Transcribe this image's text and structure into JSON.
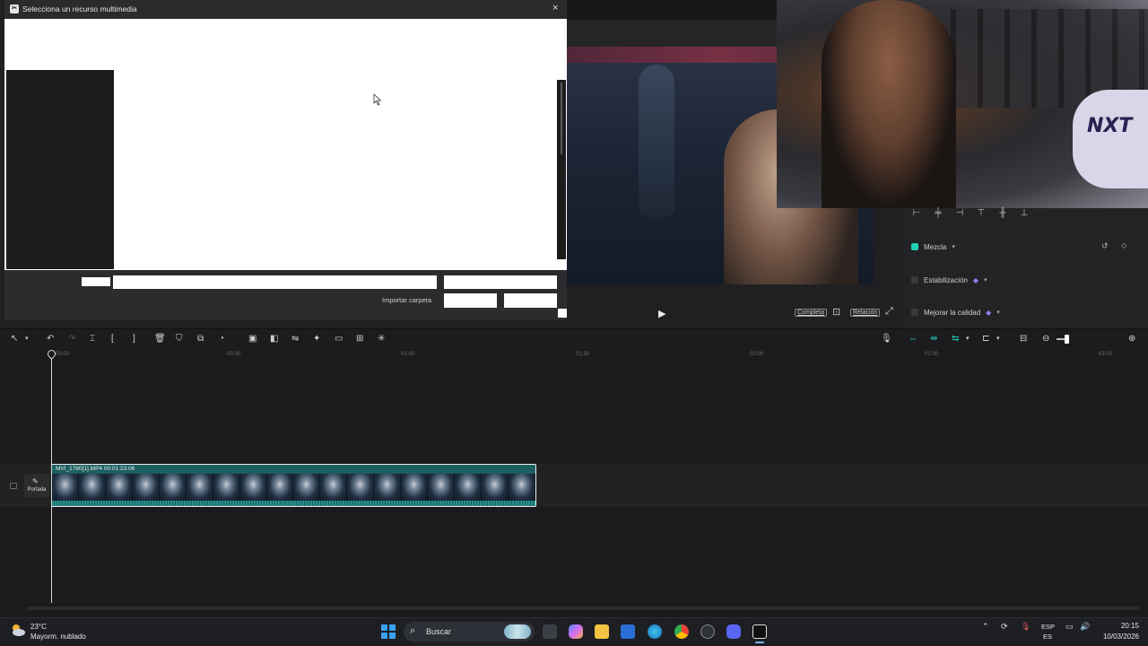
{
  "modal": {
    "title": "Selecciona un recurso multimedia",
    "close_icon": "×",
    "import_folder_label": "Importar carpeta"
  },
  "player": {
    "full_label": "Completa",
    "ratio_label": "Relación"
  },
  "properties": {
    "items": [
      {
        "label": "Mezcla",
        "checked": true
      },
      {
        "label": "Estabilización",
        "checked": false,
        "premium": true
      },
      {
        "label": "Mejorar la calidad",
        "checked": false,
        "premium": true
      }
    ]
  },
  "webcam": {
    "pillow_text": "NXT"
  },
  "timeline": {
    "ticks": [
      "00:00",
      "00:30",
      "01:00",
      "01:30",
      "02:00",
      "02:30",
      "03:00"
    ],
    "clip_label": "MVI_1780[1].MP4   00:01:23:06",
    "cover_label": "Portada"
  },
  "taskbar": {
    "weather_temp": "23°C",
    "weather_desc": "Mayorm. nublado",
    "search_label": "Buscar",
    "lang_top": "ESP",
    "lang_bottom": "ES",
    "time": "20:15",
    "date": "10/03/2026"
  },
  "colors": {
    "accent": "#21c7b3",
    "premium": "#8e7ef2",
    "clip": "#1c5f61"
  }
}
